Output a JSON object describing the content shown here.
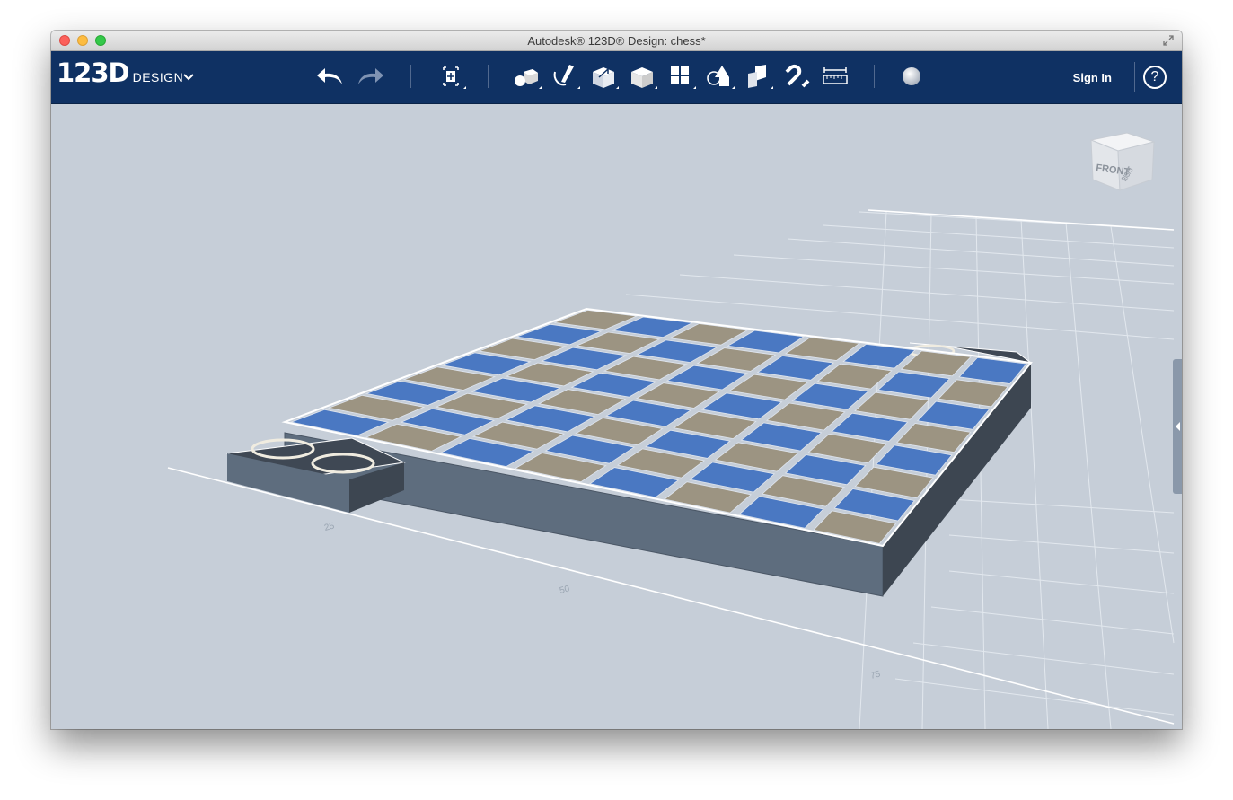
{
  "window": {
    "title": "Autodesk® 123D® Design: chess*"
  },
  "logo": {
    "number": "123D",
    "product": "DESIGN"
  },
  "toolbar": {
    "buttons": [
      {
        "name": "undo",
        "icon": "undo-arrow-icon"
      },
      {
        "name": "redo",
        "icon": "redo-arrow-icon"
      },
      {
        "name": "transform",
        "icon": "transform-icon"
      },
      {
        "name": "primitives",
        "icon": "primitives-icon"
      },
      {
        "name": "sketch",
        "icon": "sketch-icon"
      },
      {
        "name": "construct",
        "icon": "construct-icon"
      },
      {
        "name": "modify",
        "icon": "modify-icon"
      },
      {
        "name": "pattern",
        "icon": "pattern-icon"
      },
      {
        "name": "group",
        "icon": "group-icon"
      },
      {
        "name": "combine",
        "icon": "combine-icon"
      },
      {
        "name": "snap",
        "icon": "snap-magnet-icon"
      },
      {
        "name": "measure",
        "icon": "measure-ruler-icon"
      },
      {
        "name": "material",
        "icon": "material-sphere-icon"
      }
    ],
    "sign_in_label": "Sign In",
    "help_label": "?"
  },
  "viewcube": {
    "front_label": "FRONT",
    "right_label": "RIGHT"
  },
  "grid": {
    "axis_labels": [
      "25",
      "50",
      "75"
    ]
  },
  "colors": {
    "toolbar_bg": "#0f3163",
    "viewport_bg": "#c6ced8",
    "square_blue": "#4a78c2",
    "square_tan": "#9c9482",
    "board_side": "#5e6d7e"
  }
}
